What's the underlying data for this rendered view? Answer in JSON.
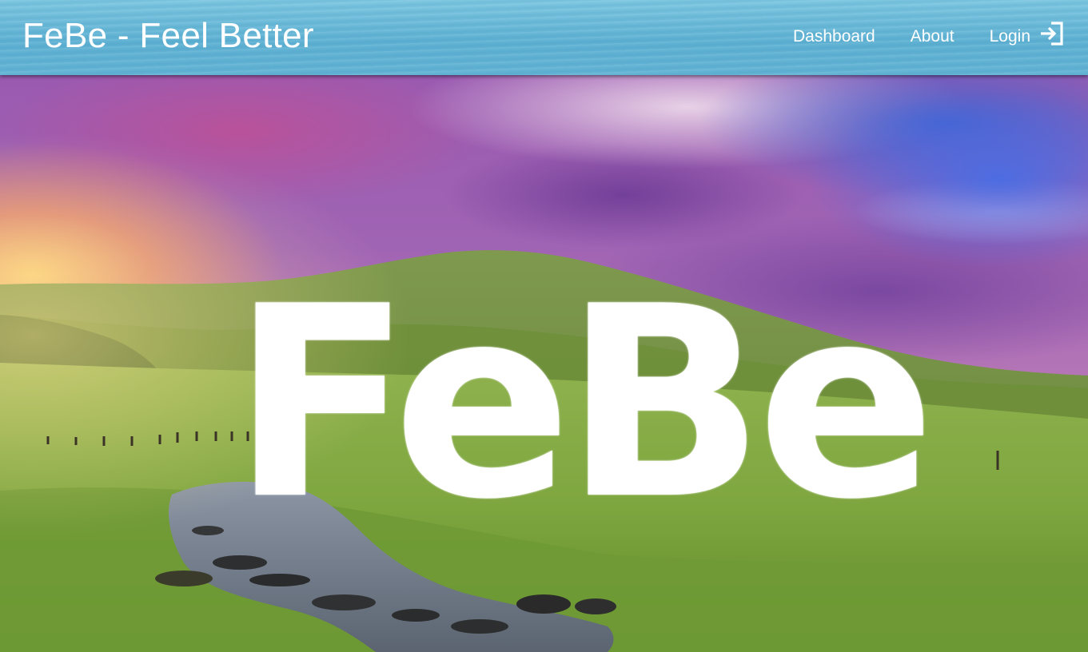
{
  "header": {
    "brand": "FeBe - Feel Better",
    "nav": [
      {
        "label": "Dashboard"
      },
      {
        "label": "About"
      },
      {
        "label": "Login"
      }
    ],
    "login_icon": "login-icon"
  },
  "hero": {
    "logo_text": "FeBe",
    "background": "landscape-photo"
  },
  "colors": {
    "topbar": "#62b3d4",
    "text": "#ffffff"
  }
}
